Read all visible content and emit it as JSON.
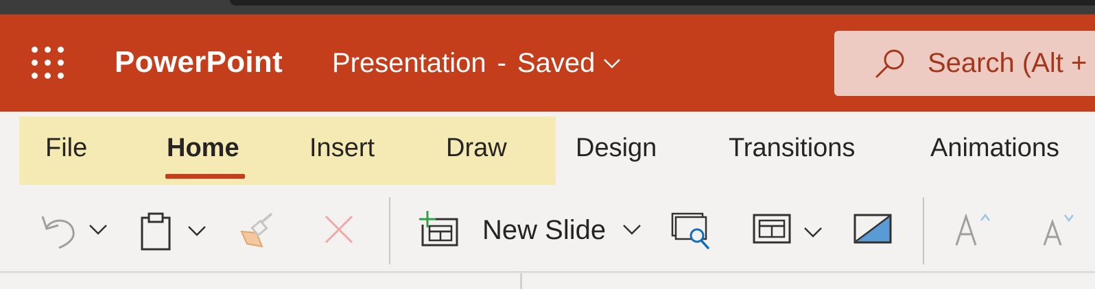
{
  "app": {
    "name": "PowerPoint"
  },
  "document": {
    "name": "Presentation",
    "separator": "-",
    "status": "Saved"
  },
  "search": {
    "placeholder": "Search (Alt + Q)"
  },
  "tabs": [
    "File",
    "Home",
    "Insert",
    "Draw",
    "Design",
    "Transitions",
    "Animations"
  ],
  "active_tab": "Home",
  "ribbon": {
    "new_slide_label": "New Slide",
    "buttons": [
      "undo-icon",
      "paste-icon",
      "format-painter-icon",
      "delete-icon",
      "new-slide-icon",
      "reuse-slides-icon",
      "layout-icon",
      "background-icon",
      "increase-font-icon",
      "decrease-font-icon"
    ]
  },
  "colors": {
    "brand": "#c43e1c",
    "tab_highlight": "#f5eab4",
    "ribbon_bg": "#f3f2f1",
    "search_bg": "#edcbc2"
  }
}
